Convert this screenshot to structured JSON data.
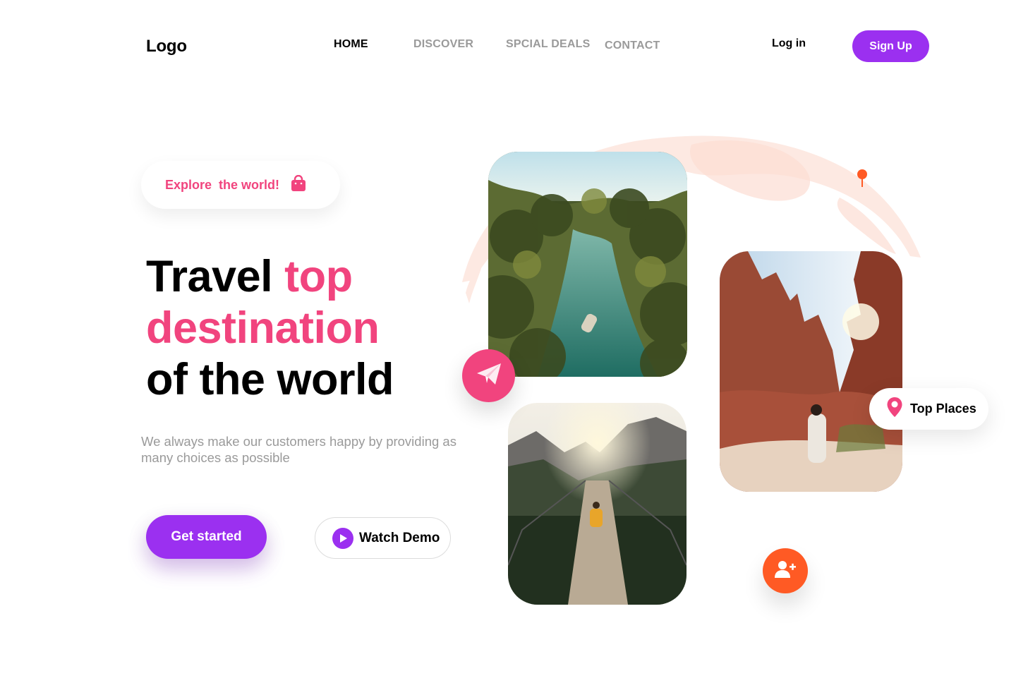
{
  "header": {
    "logo": "Logo",
    "nav": [
      {
        "label": "HOME",
        "active": true
      },
      {
        "label": "DISCOVER",
        "active": false
      },
      {
        "label": "SPCIAL DEALS",
        "active": false
      },
      {
        "label": "CONTACT",
        "active": false
      }
    ],
    "login_label": "Log in",
    "signup_label": "Sign Up"
  },
  "hero": {
    "badge_text": "Explore  the world!",
    "badge_icon": "shopping-bag-icon",
    "title_part1": "Travel ",
    "title_highlight_1": "top",
    "title_highlight_2": "destination",
    "title_part2": "of the world",
    "subtitle": "We always make our customers happy by providing as many choices as possible",
    "cta_primary": "Get started",
    "cta_secondary": "Watch Demo"
  },
  "gallery": {
    "floating_label": "Top Places",
    "icons": [
      "send-icon",
      "map-pin-icon",
      "user-plus-icon",
      "location-pin-icon"
    ]
  },
  "colors": {
    "accent_purple": "#9b30f0",
    "accent_pink": "#f1447e",
    "accent_orange": "#ff5a24",
    "muted_text": "#9a9a9a",
    "globe": "#fde9e2"
  }
}
